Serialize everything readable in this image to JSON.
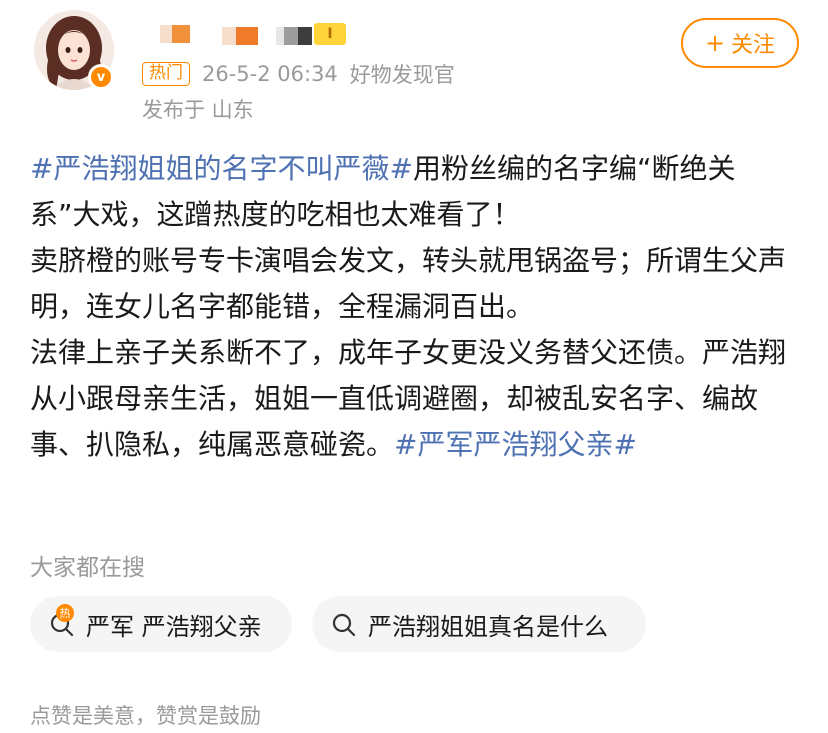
{
  "post": {
    "hot_tag": "热门",
    "date": "26-5-2 06:34",
    "source": "好物发现官",
    "publish_location": "发布于 山东",
    "level_badge": "I",
    "verified_badge": "v"
  },
  "follow_button": {
    "plus": "+",
    "label": "关注"
  },
  "content": {
    "p1_topic": "#严浩翔姐姐的名字不叫严薇#",
    "p1_text": "用粉丝编的名字编“断绝关系”大戏，这蹭热度的吃相也太难看了！",
    "p2_text": "卖脐橙的账号专卡演唱会发文，转头就甩锅盗号；所谓生父声明，连女儿名字都能错，全程漏洞百出。",
    "p3_text": "法律上亲子关系断不了，成年子女更没义务替父还债。严浩翔从小跟母亲生活，姐姐一直低调避圈，却被乱安名字、编故事、扒隐私，纯属恶意碰瓷。",
    "p3_topic": "#严军严浩翔父亲#"
  },
  "search": {
    "title": "大家都在搜",
    "chips": [
      {
        "icon": "hot-search-icon",
        "hot_label": "热",
        "label": "严军 严浩翔父亲"
      },
      {
        "icon": "search-icon",
        "label": "严浩翔姐姐真名是什么"
      }
    ]
  },
  "footer": {
    "text": "点赞是美意，赞赏是鼓励"
  },
  "colors": {
    "accent": "#ff8a00",
    "topic_link": "#4f72b2",
    "muted": "#9a9a9a"
  }
}
